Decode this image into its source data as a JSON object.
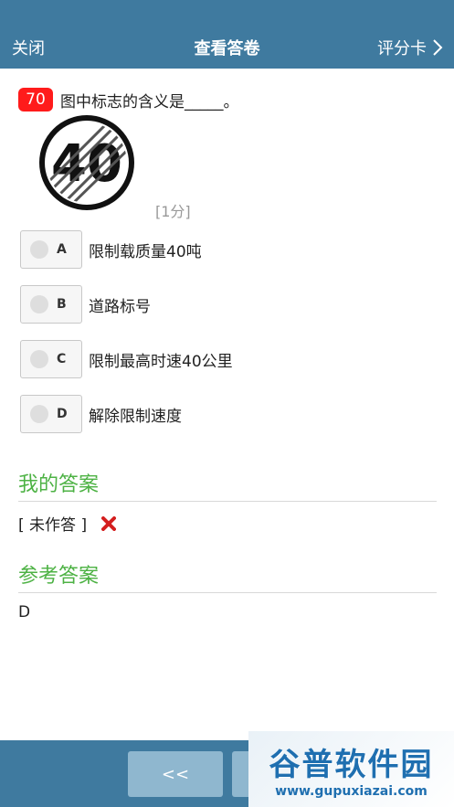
{
  "header": {
    "close_label": "关闭",
    "title": "查看答卷",
    "scorecard_label": "评分卡"
  },
  "question": {
    "number": "70",
    "text": "图中标志的含义是_____。",
    "sign_text": "40",
    "score": "[1分]"
  },
  "options": [
    {
      "letter": "A",
      "text": "限制载质量40吨"
    },
    {
      "letter": "B",
      "text": "道路标号"
    },
    {
      "letter": "C",
      "text": "限制最高时速40公里"
    },
    {
      "letter": "D",
      "text": "解除限制速度"
    }
  ],
  "my_answer": {
    "title": "我的答案",
    "value": "[ 未作答 ]"
  },
  "reference_answer": {
    "title": "参考答案",
    "value": "D"
  },
  "footer": {
    "prev_label": "<<"
  },
  "watermark": {
    "line1": "谷普软件园",
    "line2": "www.gupuxiazai.com"
  },
  "colors": {
    "bar": "#3f7a9f",
    "accent_green": "#4db244",
    "badge_red": "#ff1b1b"
  }
}
